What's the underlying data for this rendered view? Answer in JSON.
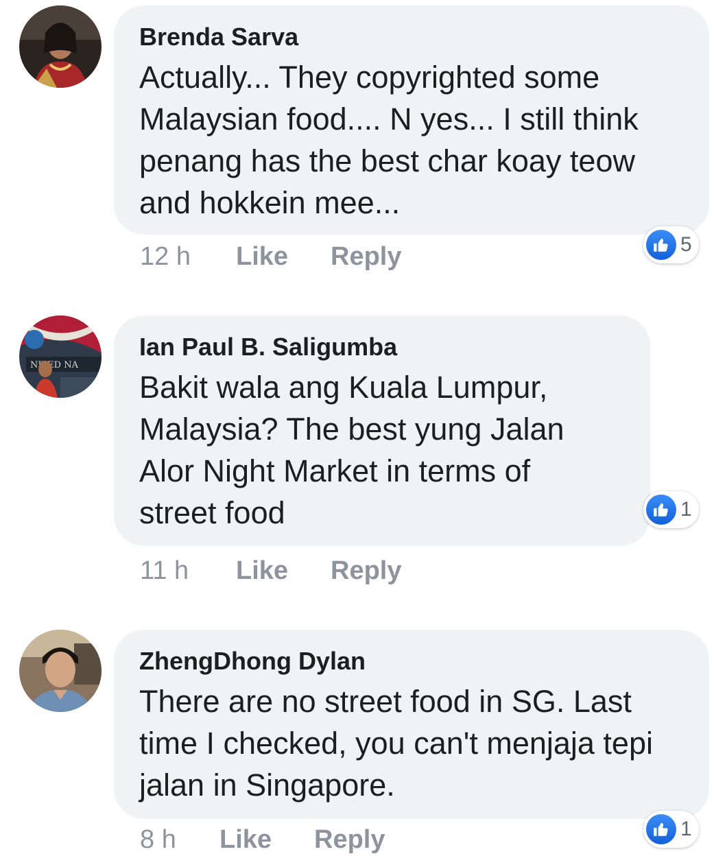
{
  "comments": [
    {
      "author": "Brenda Sarva",
      "text": "Actually... They copyrighted some\nMalaysian food.... N yes... I still think\npenang has the best char koay teow\nand hokkein mee...",
      "time": "12 h",
      "like_label": "Like",
      "reply_label": "Reply",
      "reaction_count": "5"
    },
    {
      "author": "Ian Paul B. Saligumba",
      "text": "Bakit wala ang Kuala Lumpur,\nMalaysia? The best yung Jalan\nAlor Night Market in terms of\nstreet food",
      "time": "11 h",
      "like_label": "Like",
      "reply_label": "Reply",
      "reaction_count": "1"
    },
    {
      "author": "ZhengDhong Dylan",
      "text": "There are no street food in SG. Last\ntime I checked, you can't menjaja tepi\njalan in Singapore.",
      "time": "8 h",
      "like_label": "Like",
      "reply_label": "Reply",
      "reaction_count": "1"
    }
  ],
  "colors": {
    "bubble": "#f0f2f5",
    "author": "#1c1e21",
    "meta": "#8d949e",
    "like_blue": "#1877f2"
  },
  "icons": {
    "reaction": "thumbs-up-icon"
  }
}
